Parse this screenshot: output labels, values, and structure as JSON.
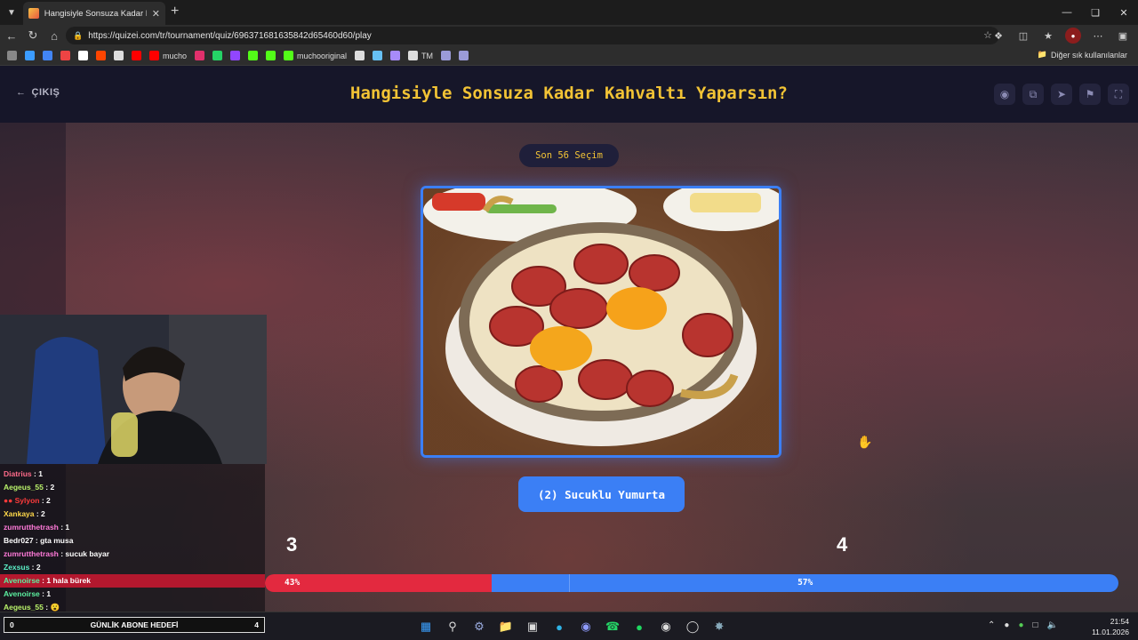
{
  "browser": {
    "tab_title": "Hangisiyle Sonsuza Kadar Kahvalt",
    "url": "https://quizei.com/tr/tournament/quiz/696371681635842d65460d60/play",
    "bookmarks": [
      {
        "label": "",
        "color": "#888"
      },
      {
        "label": "",
        "color": "#3b9cff"
      },
      {
        "label": "",
        "color": "#4285f4"
      },
      {
        "label": "",
        "color": "#e44"
      },
      {
        "label": "",
        "color": "#fff"
      },
      {
        "label": "",
        "color": "#ff4500"
      },
      {
        "label": "",
        "color": "#ddd"
      },
      {
        "label": "",
        "color": "#ff0000"
      },
      {
        "label": "mucho",
        "color": "#ff0000"
      },
      {
        "label": "",
        "color": "#e1306c"
      },
      {
        "label": "",
        "color": "#25d366"
      },
      {
        "label": "",
        "color": "#9146ff"
      },
      {
        "label": "",
        "color": "#53fc18"
      },
      {
        "label": "",
        "color": "#53fc18"
      },
      {
        "label": "muchooriginal",
        "color": "#53fc18"
      },
      {
        "label": "",
        "color": "#ddd"
      },
      {
        "label": "",
        "color": "#66c0f4"
      },
      {
        "label": "",
        "color": "#a78bfa"
      },
      {
        "label": "TM",
        "color": "#ddd"
      },
      {
        "label": "",
        "color": "#9b9bd8"
      },
      {
        "label": "",
        "color": "#9b9bd8"
      }
    ],
    "other_bookmarks": "Diğer sık kullanılanlar"
  },
  "header": {
    "exit_label": "ÇIKIŞ",
    "title": "Hangisiyle Sonsuza Kadar Kahvaltı Yaparsın?"
  },
  "round": {
    "label": "Son 56 Seçim"
  },
  "choice": {
    "label": "(2) Sucuklu Yumurta"
  },
  "votes": {
    "left_count": "3",
    "right_count": "4",
    "left_percent_label": "43%",
    "right_percent_label": "57%",
    "left_fraction": 0.266,
    "right_fraction": 0.734
  },
  "chat": [
    {
      "user": "Diatrius",
      "msg": " : 1",
      "color": "#ff6b8a",
      "hl": false
    },
    {
      "user": "Aegeus_55",
      "msg": " : 2",
      "color": "#b9f26a",
      "hl": false
    },
    {
      "user": "●● Sylyon",
      "msg": " : 2",
      "color": "#ff3b3b",
      "hl": false
    },
    {
      "user": "Xankaya",
      "msg": " : 2",
      "color": "#ffd84a",
      "hl": false
    },
    {
      "user": "zumrutthetrash",
      "msg": " : 1",
      "color": "#ff7ad9",
      "hl": false
    },
    {
      "user": "Bedr027",
      "msg": " : gta musa",
      "color": "#ffffff",
      "hl": false
    },
    {
      "user": "zumrutthetrash",
      "msg": " : sucuk bayar",
      "color": "#ff7ad9",
      "hl": false
    },
    {
      "user": "Zexsus",
      "msg": " : 2",
      "color": "#5cf0c8",
      "hl": false
    },
    {
      "user": "Avenoirse",
      "msg": " : 1 hala bürek",
      "color": "#5cf0a0",
      "hl": true
    },
    {
      "user": "Avenoirse",
      "msg": " : 1",
      "color": "#5cf0a0",
      "hl": false
    },
    {
      "user": "Aegeus_55",
      "msg": " : 😮",
      "color": "#b9f26a",
      "hl": false
    }
  ],
  "goal": {
    "left": "0",
    "label": "GÜNLİK ABONE HEDEFİ",
    "right": "4"
  },
  "taskbar": {
    "time": "21:54",
    "date": "11.01.2026"
  }
}
